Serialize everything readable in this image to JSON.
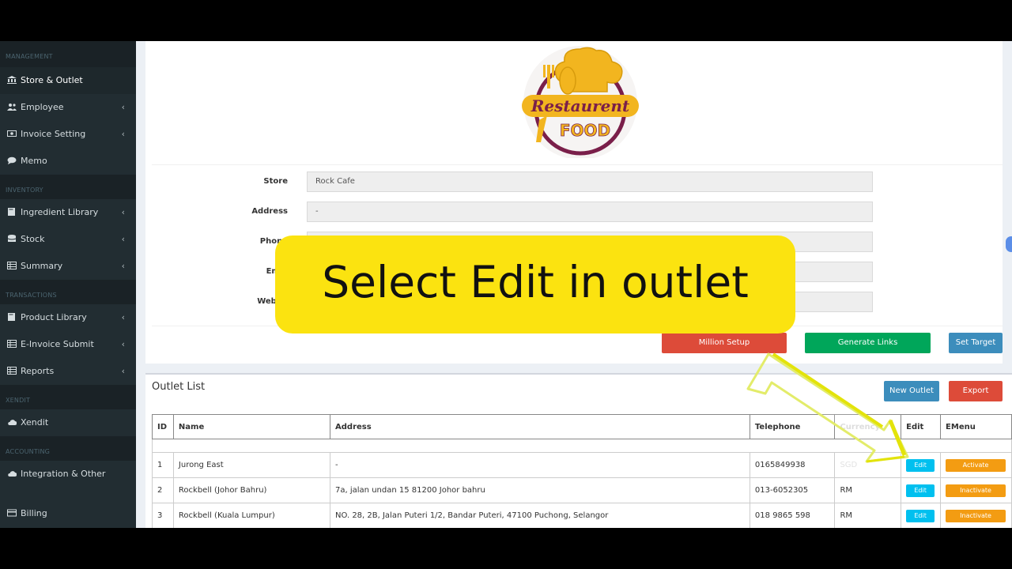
{
  "sidebar": {
    "headers": {
      "management": "MANAGEMENT",
      "inventory": "INVENTORY",
      "transactions": "TRANSACTIONS",
      "xendit": "XENDIT",
      "accounting": "ACCOUNTING"
    },
    "items": {
      "store_outlet": "Store & Outlet",
      "employee": "Employee",
      "invoice_setting": "Invoice Setting",
      "memo": "Memo",
      "ingredient_library": "Ingredient Library",
      "stock": "Stock",
      "summary": "Summary",
      "product_library": "Product Library",
      "e_invoice_submit": "E-Invoice Submit",
      "reports": "Reports",
      "xendit": "Xendit",
      "integration_other": "Integration & Other",
      "billing": "Billing"
    },
    "chevron": "‹"
  },
  "logo": {
    "line1": "Restaurent",
    "line2": "FOOD"
  },
  "store_form": {
    "store_label": "Store",
    "store_value": "Rock Cafe",
    "address_label": "Address",
    "address_value": "-",
    "phone_label": "Phone",
    "email_label": "Emai",
    "website_label": "Websit"
  },
  "buttons": {
    "million_setup": "Million Setup",
    "generate_links": "Generate Links",
    "set_target": "Set Target",
    "new_outlet": "New Outlet",
    "export": "Export"
  },
  "outlet_list": {
    "title": "Outlet List",
    "columns": [
      "ID",
      "Name",
      "Address",
      "Telephone",
      "Currency",
      "Edit",
      "EMenu"
    ],
    "rows": [
      {
        "id": "1",
        "name": "Jurong East",
        "address": "-",
        "telephone": "0165849938",
        "currency": "SGD",
        "edit": "Edit",
        "emenu": "Activate"
      },
      {
        "id": "2",
        "name": "Rockbell (Johor Bahru)",
        "address": "7a, jalan undan 15 81200 Johor bahru",
        "telephone": "013-6052305",
        "currency": "RM",
        "edit": "Edit",
        "emenu": "Inactivate"
      },
      {
        "id": "3",
        "name": "Rockbell (Kuala Lumpur)",
        "address": "NO. 28, 2B, Jalan Puteri 1/2, Bandar Puteri, 47100 Puchong, Selangor",
        "telephone": "018 9865 598",
        "currency": "RM",
        "edit": "Edit",
        "emenu": "Inactivate"
      }
    ]
  },
  "overlay": {
    "caption": "Select Edit in outlet"
  },
  "colors": {
    "sidebar_bg": "#222d32",
    "red": "#dd4b39",
    "green": "#00a65a",
    "blue": "#3c8dbc",
    "cyan": "#00c0ef",
    "orange": "#f39c12",
    "banner_yellow": "#fbe310"
  }
}
